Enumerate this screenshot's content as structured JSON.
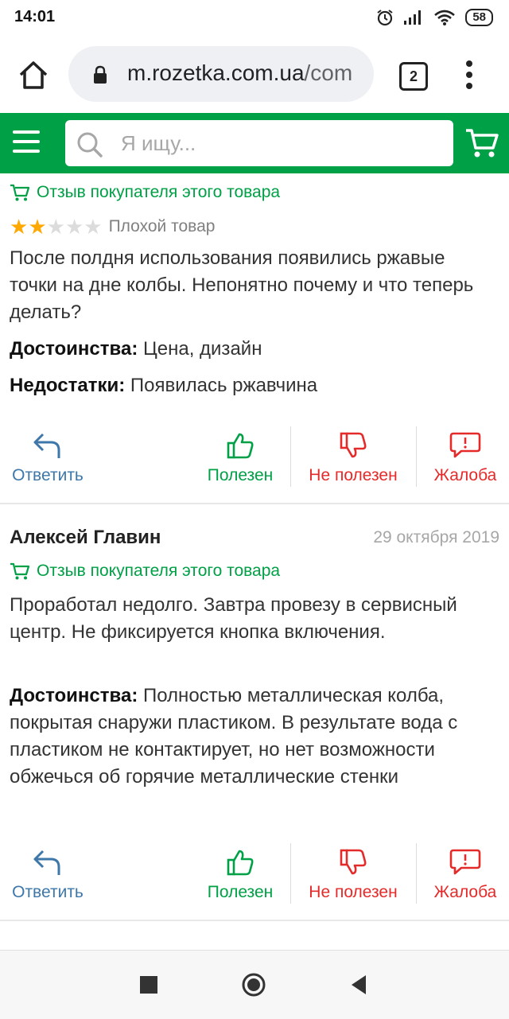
{
  "status": {
    "time": "14:01",
    "battery": "58"
  },
  "browser": {
    "url_domain": "m.rozetka.com.ua",
    "url_path": "/com",
    "tab_count": "2"
  },
  "header": {
    "search_placeholder": "Я ищу..."
  },
  "colors": {
    "brand": "#00a046",
    "star": "#ffa900",
    "reply": "#3e77aa",
    "report": "#e52a2a"
  },
  "actions": {
    "reply": "Ответить",
    "helpful": "Полезен",
    "not_helpful": "Не полезен",
    "report": "Жалоба"
  },
  "reviews": [
    {
      "badge": "Отзыв покупателя этого товара",
      "rating": 2,
      "rating_max": 5,
      "rating_label": "Плохой товар",
      "text": "После полдня использования появились ржавые точки на дне колбы. Непонятно почему и что теперь делать?",
      "pros_label": "Достоинства:",
      "pros": "Цена, дизайн",
      "cons_label": "Недостатки:",
      "cons": "Появилась ржавчина"
    },
    {
      "author": "Алексей Главин",
      "date": "29 октября 2019",
      "badge": "Отзыв покупателя этого товара",
      "text": "Проработал недолго. Завтра провезу в сервисный центр. Не фиксируется кнопка включения.",
      "pros_label": "Достоинства:",
      "pros": "Полностью металлическая колба, покрытая снаружи пластиком. В результате вода с пластиком не контактирует, но нет возможности обжечься об горячие металлические стенки"
    }
  ]
}
